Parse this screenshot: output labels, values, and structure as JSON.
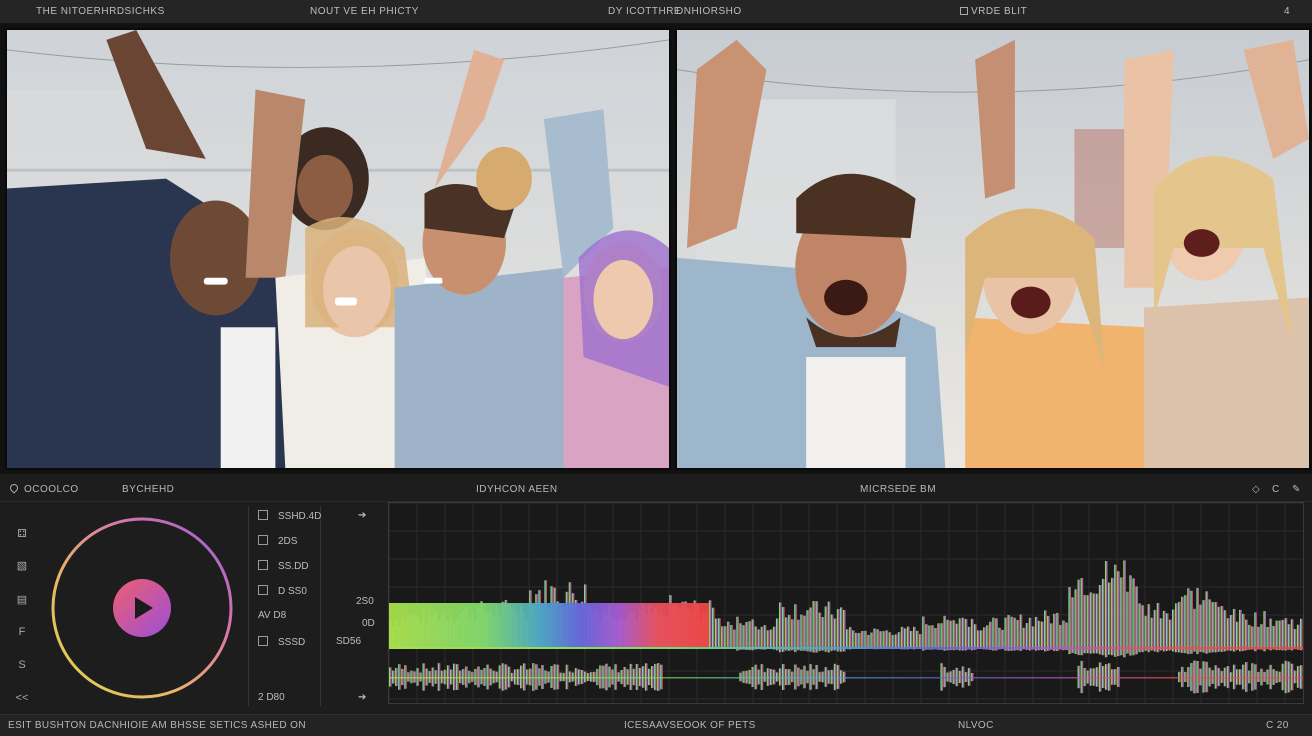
{
  "topbar": {
    "app_title": "THE NITOERHRDSICHKS",
    "center_title": "NOUT VE EH PHICTY",
    "right_title": "DY ICOTTHRE",
    "panel2_title": "DNHIORSHO",
    "panel2_meta": "VRDE BLIT",
    "corner_label": "4"
  },
  "bottom_header": {
    "left_label": "OCOOLCO",
    "left_label2": "BYCHEHD",
    "center_label": "IDYHCON AEEN",
    "right_label": "MICRSEDE BM",
    "right_label2": "C"
  },
  "sidebar": {
    "icons": [
      "camera-icon",
      "image-icon",
      "file-icon",
      "text-f-icon",
      "text-s-icon",
      "rewind-icon"
    ],
    "glyphs": [
      "⚃",
      "▧",
      "▤",
      "F",
      "S",
      "<<"
    ]
  },
  "playlist": {
    "rows": [
      {
        "label": "SSHD.4D"
      },
      {
        "label": "2DS"
      },
      {
        "label": "SS.DD"
      },
      {
        "label": "D SS0"
      },
      {
        "label": "SSSD"
      }
    ],
    "row_ms_label": "AV D8",
    "bottom_label": "2 D80"
  },
  "wave_axis": {
    "labels": [
      "2S0",
      "0D",
      "SD56"
    ]
  },
  "statusbar": {
    "left": "ESIT BUSHTON DACNHIOIE AM BHSSE SETICS ASHED ON",
    "center": "ICESAAVSEOOK OF PETS",
    "right": "NLVOC",
    "far_right": "C 20"
  },
  "colors": {
    "wave_start": "#9be04a",
    "wave_mid": "#5f63d8",
    "wave_end": "#ee4848"
  }
}
